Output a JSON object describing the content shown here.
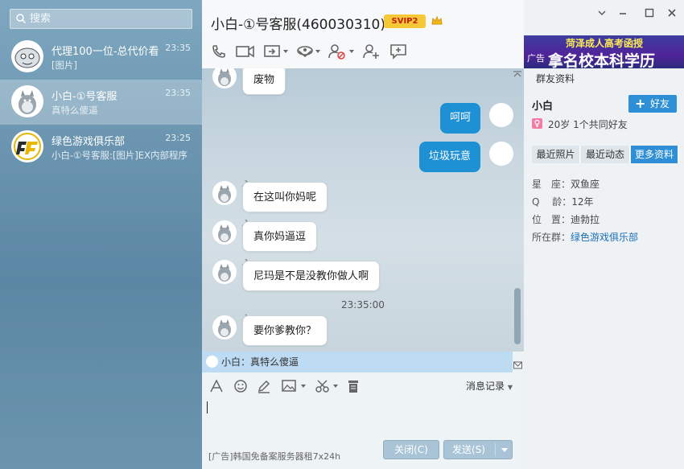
{
  "search": {
    "placeholder": "搜索"
  },
  "contacts": [
    {
      "name": "代理100一位-总代价看",
      "preview": "[图片]",
      "time": "23:35"
    },
    {
      "name": "小白-①号客服",
      "preview": "真特么傻逼",
      "time": "23:35"
    },
    {
      "name": "绿色游戏俱乐部",
      "preview": "小白-①号客服:[图片]EX内部程序",
      "time": "23:25"
    }
  ],
  "chat": {
    "title": "小白-①号客服(460030310)",
    "vip_badge": "SVIP2",
    "messages": [
      {
        "side": "left",
        "text": "废物"
      },
      {
        "side": "right",
        "text": "呵呵"
      },
      {
        "side": "right",
        "text": "垃圾玩意"
      },
      {
        "side": "left",
        "text": "在这叫你妈呢"
      },
      {
        "side": "left",
        "text": "真你妈逼逗"
      },
      {
        "side": "left",
        "text": "尼玛是不是没教你做人啊"
      },
      {
        "side": "left",
        "text": "要你爹教你？"
      }
    ],
    "timestamp": "23:35:00",
    "notice": "小白：真特么傻逼",
    "history_label": "消息记录",
    "ad_text": "[广告]韩国免备案服务器租7x24h",
    "close_label": "关闭(C)",
    "send_label": "发送(S)"
  },
  "profile": {
    "banner_line1": "菏泽成人高考函授",
    "banner_line2": "拿名校本科学历",
    "banner_tag": "广告",
    "section_label": "群友资料",
    "name": "小白",
    "add_label": "好友",
    "info": "20岁 1个共同好友",
    "tabs": [
      "最近照片",
      "最近动态",
      "更多资料"
    ],
    "active_tab": 2,
    "fields": [
      {
        "label": "星　座：",
        "value": "双鱼座"
      },
      {
        "label": "Q　 龄：",
        "value": "12年"
      },
      {
        "label": "位　置：",
        "value": "迪勃拉"
      },
      {
        "label": "所在群：",
        "value": "绿色游戏俱乐部"
      }
    ]
  },
  "colors": {
    "accent": "#2e8fd6",
    "bubble_right": "#1e90d4",
    "svip": "#f6c736"
  },
  "icons": [
    "search-icon",
    "phone-icon",
    "video-icon",
    "share-screen-icon",
    "app-icon",
    "block-user-icon",
    "add-user-icon",
    "add-chat-icon",
    "font-icon",
    "emoji-icon",
    "pen-icon",
    "image-icon",
    "scissors-icon",
    "trash-icon",
    "minimize-icon",
    "maximize-icon",
    "close-icon"
  ]
}
